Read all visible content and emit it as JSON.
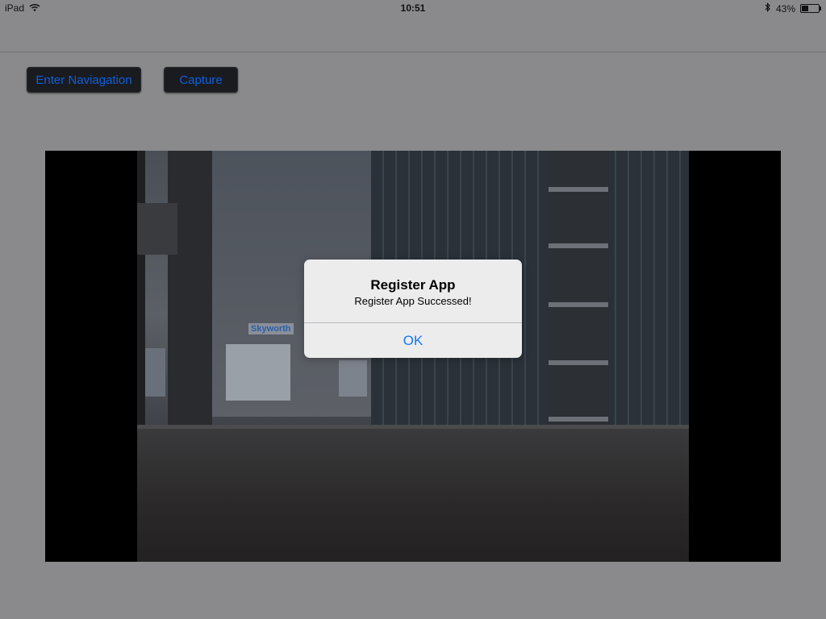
{
  "status_bar": {
    "device": "iPad",
    "time": "10:51",
    "battery_text": "43%",
    "battery_level": 0.43,
    "icons": [
      "wifi-icon",
      "bluetooth-icon",
      "battery-icon"
    ]
  },
  "toolbar": {
    "enter_navigation_label": "Enter Naviagation",
    "capture_label": "Capture"
  },
  "video": {
    "sign_text": "Skyworth"
  },
  "alert": {
    "title": "Register App",
    "message": "Register App Successed!",
    "ok_label": "OK"
  },
  "colors": {
    "accent": "#1677f0",
    "button_text": "#0f5fe0",
    "background": "#8a8a8c"
  }
}
